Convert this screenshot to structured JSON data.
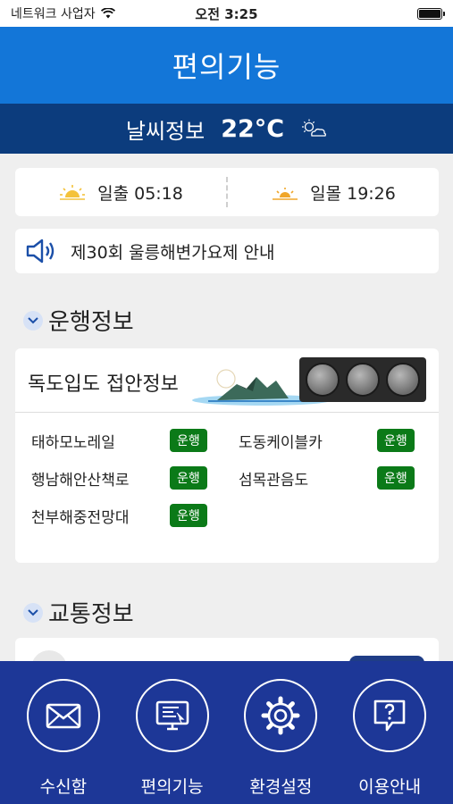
{
  "status_bar": {
    "carrier": "네트워크 사업자",
    "time": "오전 3:25"
  },
  "header": {
    "title": "편의기능"
  },
  "weather": {
    "label": "날씨정보",
    "temp": "22°C"
  },
  "sun": {
    "sunrise": "일출 05:18",
    "sunset": "일몰 19:26"
  },
  "notice": {
    "text": "제30회 울릉해변가요제 안내"
  },
  "operations": {
    "section_title": "운행정보",
    "dokdo_title": "독도입도 접안정보",
    "items": [
      {
        "name": "태하모노레일",
        "status": "운행"
      },
      {
        "name": "도동케이블카",
        "status": "운행"
      },
      {
        "name": "행남해안산책로",
        "status": "운행"
      },
      {
        "name": "섬목관음도",
        "status": "운행"
      },
      {
        "name": "천부해중전망대",
        "status": "운행"
      }
    ],
    "status_color": "#0b7a18"
  },
  "traffic": {
    "section_title": "교통정보"
  },
  "tabs": [
    {
      "label": "수신함",
      "icon": "envelope-icon"
    },
    {
      "label": "편의기능",
      "icon": "monitor-icon"
    },
    {
      "label": "환경설정",
      "icon": "gear-icon"
    },
    {
      "label": "이용안내",
      "icon": "help-bubble-icon"
    }
  ],
  "colors": {
    "header": "#1376d8",
    "weather_bar": "#0c3c7d",
    "tab_bar": "#1d3797"
  }
}
